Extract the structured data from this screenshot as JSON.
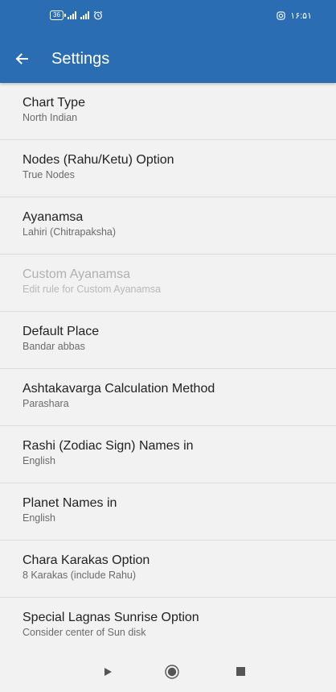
{
  "status_bar": {
    "battery": "36",
    "time": "۱۶:۵۱"
  },
  "app_bar": {
    "title": "Settings"
  },
  "settings": [
    {
      "title": "Chart Type",
      "value": "North Indian",
      "enabled": true
    },
    {
      "title": "Nodes (Rahu/Ketu) Option",
      "value": "True Nodes",
      "enabled": true
    },
    {
      "title": "Ayanamsa",
      "value": "Lahiri (Chitrapaksha)",
      "enabled": true
    },
    {
      "title": "Custom Ayanamsa",
      "value": "Edit rule for Custom Ayanamsa",
      "enabled": false
    },
    {
      "title": "Default Place",
      "value": "Bandar abbas",
      "enabled": true
    },
    {
      "title": "Ashtakavarga Calculation Method",
      "value": "Parashara",
      "enabled": true
    },
    {
      "title": "Rashi (Zodiac Sign) Names in",
      "value": "English",
      "enabled": true
    },
    {
      "title": "Planet Names in",
      "value": "English",
      "enabled": true
    },
    {
      "title": "Chara Karakas Option",
      "value": "8 Karakas (include Rahu)",
      "enabled": true
    },
    {
      "title": "Special Lagnas Sunrise Option",
      "value": "Consider center of Sun disk",
      "enabled": true
    }
  ],
  "icons": {
    "back": "arrow-left-icon",
    "alarm": "alarm-icon",
    "instagram": "instagram-icon",
    "nav_back": "triangle-back-icon",
    "nav_home": "circle-home-icon",
    "nav_recent": "square-recent-icon"
  },
  "colors": {
    "primary": "#2a6db2",
    "background": "#f2f2f2",
    "divider": "#dcdcdc"
  }
}
